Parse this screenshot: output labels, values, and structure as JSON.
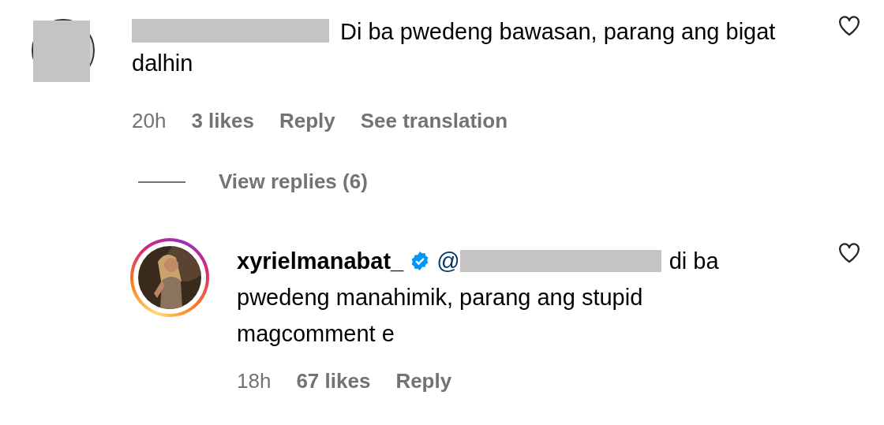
{
  "comments": [
    {
      "story_ring": false,
      "verified": false,
      "text": "Di ba pwedeng bawasan, parang ang bigat dalhin",
      "time": "20h",
      "likes": "3 likes",
      "reply": "Reply",
      "translate": "See translation",
      "view_replies": "View replies (6)",
      "liked": false
    },
    {
      "username": "xyrielmanabat_",
      "verified": true,
      "story_ring": true,
      "mention": "@",
      "text": "di ba pwedeng manahimik, parang ang stupid magcomment e",
      "time": "18h",
      "likes": "67 likes",
      "reply": "Reply",
      "liked": false
    }
  ]
}
